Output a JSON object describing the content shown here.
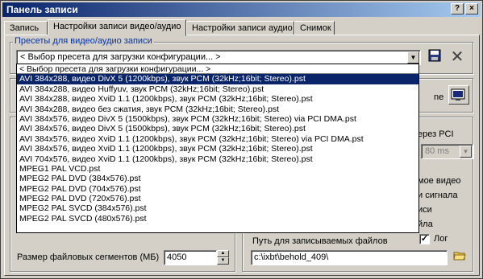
{
  "window": {
    "title": "Панель записи",
    "controls": {
      "help": "?",
      "close": "×"
    }
  },
  "tabs": [
    {
      "label": "Запись"
    },
    {
      "label": "Настройки записи видео/аудио"
    },
    {
      "label": "Настройки записи аудио"
    },
    {
      "label": "Снимок"
    }
  ],
  "presets": {
    "group_label": "Пресеты для видео/аудио записи",
    "selected": "< Выбор пресета для загрузки конфигурации... >",
    "options": [
      "< Выбор пресета для загрузки конфигурации... >",
      "AVI 384x288, видео DivX 5 (1200kbps), звук PCM (32kHz;16bit; Stereo).pst",
      "AVI 384x288, видео Huffyuv, звук PCM (32kHz;16bit; Stereo).pst",
      "AVI 384x288, видео XviD 1.1 (1200kbps), звук PCM (32kHz;16bit; Stereo).pst",
      "AVI 384x288, видео без сжатия, звук PCM (32kHz;16bit; Stereo).pst",
      "AVI 384x576, видео DivX 5 (1500kbps), звук PCM (32kHz;16bit; Stereo) via PCI DMA.pst",
      "AVI 384x576, видео DivX 5 (1500kbps), звук PCM (32kHz;16bit; Stereo).pst",
      "AVI 384x576, видео XviD 1.1 (1200kbps), звук PCM (32kHz;16bit; Stereo) via PCI DMA.pst",
      "AVI 384x576, видео XviD 1.1 (1200kbps), звук PCM (32kHz;16bit; Stereo).pst",
      "AVI 704x576, видео XviD 1.1 (1200kbps), звук PCM (32kHz;16bit; Stereo).pst",
      "MPEG1 PAL VCD.pst",
      "MPEG2 PAL DVD (384x576).pst",
      "MPEG2 PAL DVD (704x576).pst",
      "MPEG2 PAL DVD (720x576).pst",
      "MPEG2 PAL SVCD (384x576).pst",
      "MPEG2 PAL SVCD (480x576).pst"
    ],
    "highlighted_index": 1
  },
  "partial": {
    "ne": "ne",
    "erez_pci": "ерез PCI",
    "ms_value": "80 ms",
    "moe_video": "мое видео",
    "i_signala": "и сигнала",
    "isi": "иси",
    "aila": "йла",
    "log": "Лог"
  },
  "segments": {
    "label": "Размер файловых сегментов (МБ)",
    "value": "4050"
  },
  "path": {
    "label": "Путь для записываемых файлов",
    "value": "c:\\ixbt\\behold_409\\"
  }
}
